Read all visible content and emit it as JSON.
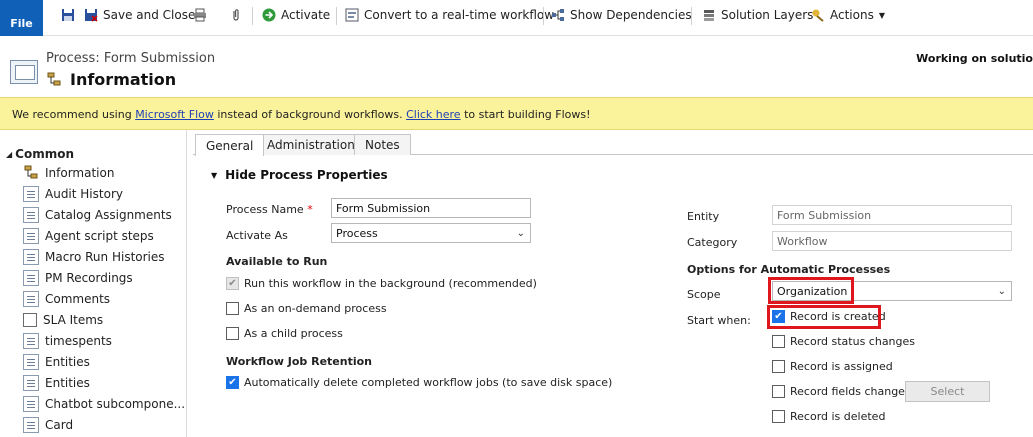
{
  "toolbar": {
    "file_label": "File",
    "save_close_label": "Save and Close",
    "activate_label": "Activate",
    "convert_label": "Convert to a real-time workflow",
    "show_dependencies_label": "Show Dependencies",
    "solution_layers_label": "Solution Layers",
    "actions_label": "Actions"
  },
  "header": {
    "subtitle": "Process: Form Submission",
    "title": "Information",
    "status": "Working on solutio"
  },
  "banner": {
    "prefix": "We recommend using ",
    "link1": "Microsoft Flow",
    "middle": " instead of background workflows. ",
    "link2": "Click here",
    "suffix": " to start building Flows!"
  },
  "nav": {
    "section": "Common",
    "items": [
      {
        "label": "Information",
        "icon": "process-icon"
      },
      {
        "label": "Audit History",
        "icon": "document-icon"
      },
      {
        "label": "Catalog Assignments",
        "icon": "document-icon"
      },
      {
        "label": "Agent script steps",
        "icon": "document-icon"
      },
      {
        "label": "Macro Run Histories",
        "icon": "document-icon"
      },
      {
        "label": "PM Recordings",
        "icon": "document-icon"
      },
      {
        "label": "Comments",
        "icon": "document-icon"
      },
      {
        "label": "SLA Items",
        "icon": "blank-icon"
      },
      {
        "label": "timespents",
        "icon": "document-icon"
      },
      {
        "label": "Entities",
        "icon": "document-icon"
      },
      {
        "label": "Entities",
        "icon": "document-icon"
      },
      {
        "label": "Chatbot subcompone...",
        "icon": "document-icon"
      },
      {
        "label": "Card",
        "icon": "document-icon"
      }
    ]
  },
  "tabs": [
    {
      "label": "General",
      "active": true
    },
    {
      "label": "Administration",
      "active": false
    },
    {
      "label": "Notes",
      "active": false
    }
  ],
  "form": {
    "section_title": "Hide Process Properties",
    "process_name_label": "Process Name",
    "required_marker": "*",
    "process_name_value": "Form Submission",
    "activate_as_label": "Activate As",
    "activate_as_value": "Process",
    "available_heading": "Available to Run",
    "background_option": "Run this workflow in the background (recommended)",
    "on_demand_option": "As an on-demand process",
    "child_option": "As a child process",
    "retention_heading": "Workflow Job Retention",
    "auto_delete_option": "Automatically delete completed workflow jobs (to save disk space)",
    "entity_label": "Entity",
    "entity_value": "Form Submission",
    "category_label": "Category",
    "category_value": "Workflow",
    "options_heading": "Options for Automatic Processes",
    "scope_label": "Scope",
    "scope_value": "Organization",
    "start_when_label": "Start when:",
    "record_created": "Record is created",
    "record_status_changes": "Record status changes",
    "record_assigned": "Record is assigned",
    "record_fields_change": "Record fields change",
    "select_label": "Select",
    "record_deleted": "Record is deleted"
  },
  "state": {
    "background_checked": true,
    "on_demand_checked": false,
    "child_checked": false,
    "auto_delete_checked": true,
    "record_created_checked": true,
    "record_status_checked": false,
    "record_assigned_checked": false,
    "record_fields_checked": false,
    "record_deleted_checked": false
  },
  "colors": {
    "file_button": "#1160b7",
    "banner_bg": "#fbf39c",
    "highlight": "#e0161e",
    "checkbox_on": "#1a73e8"
  }
}
